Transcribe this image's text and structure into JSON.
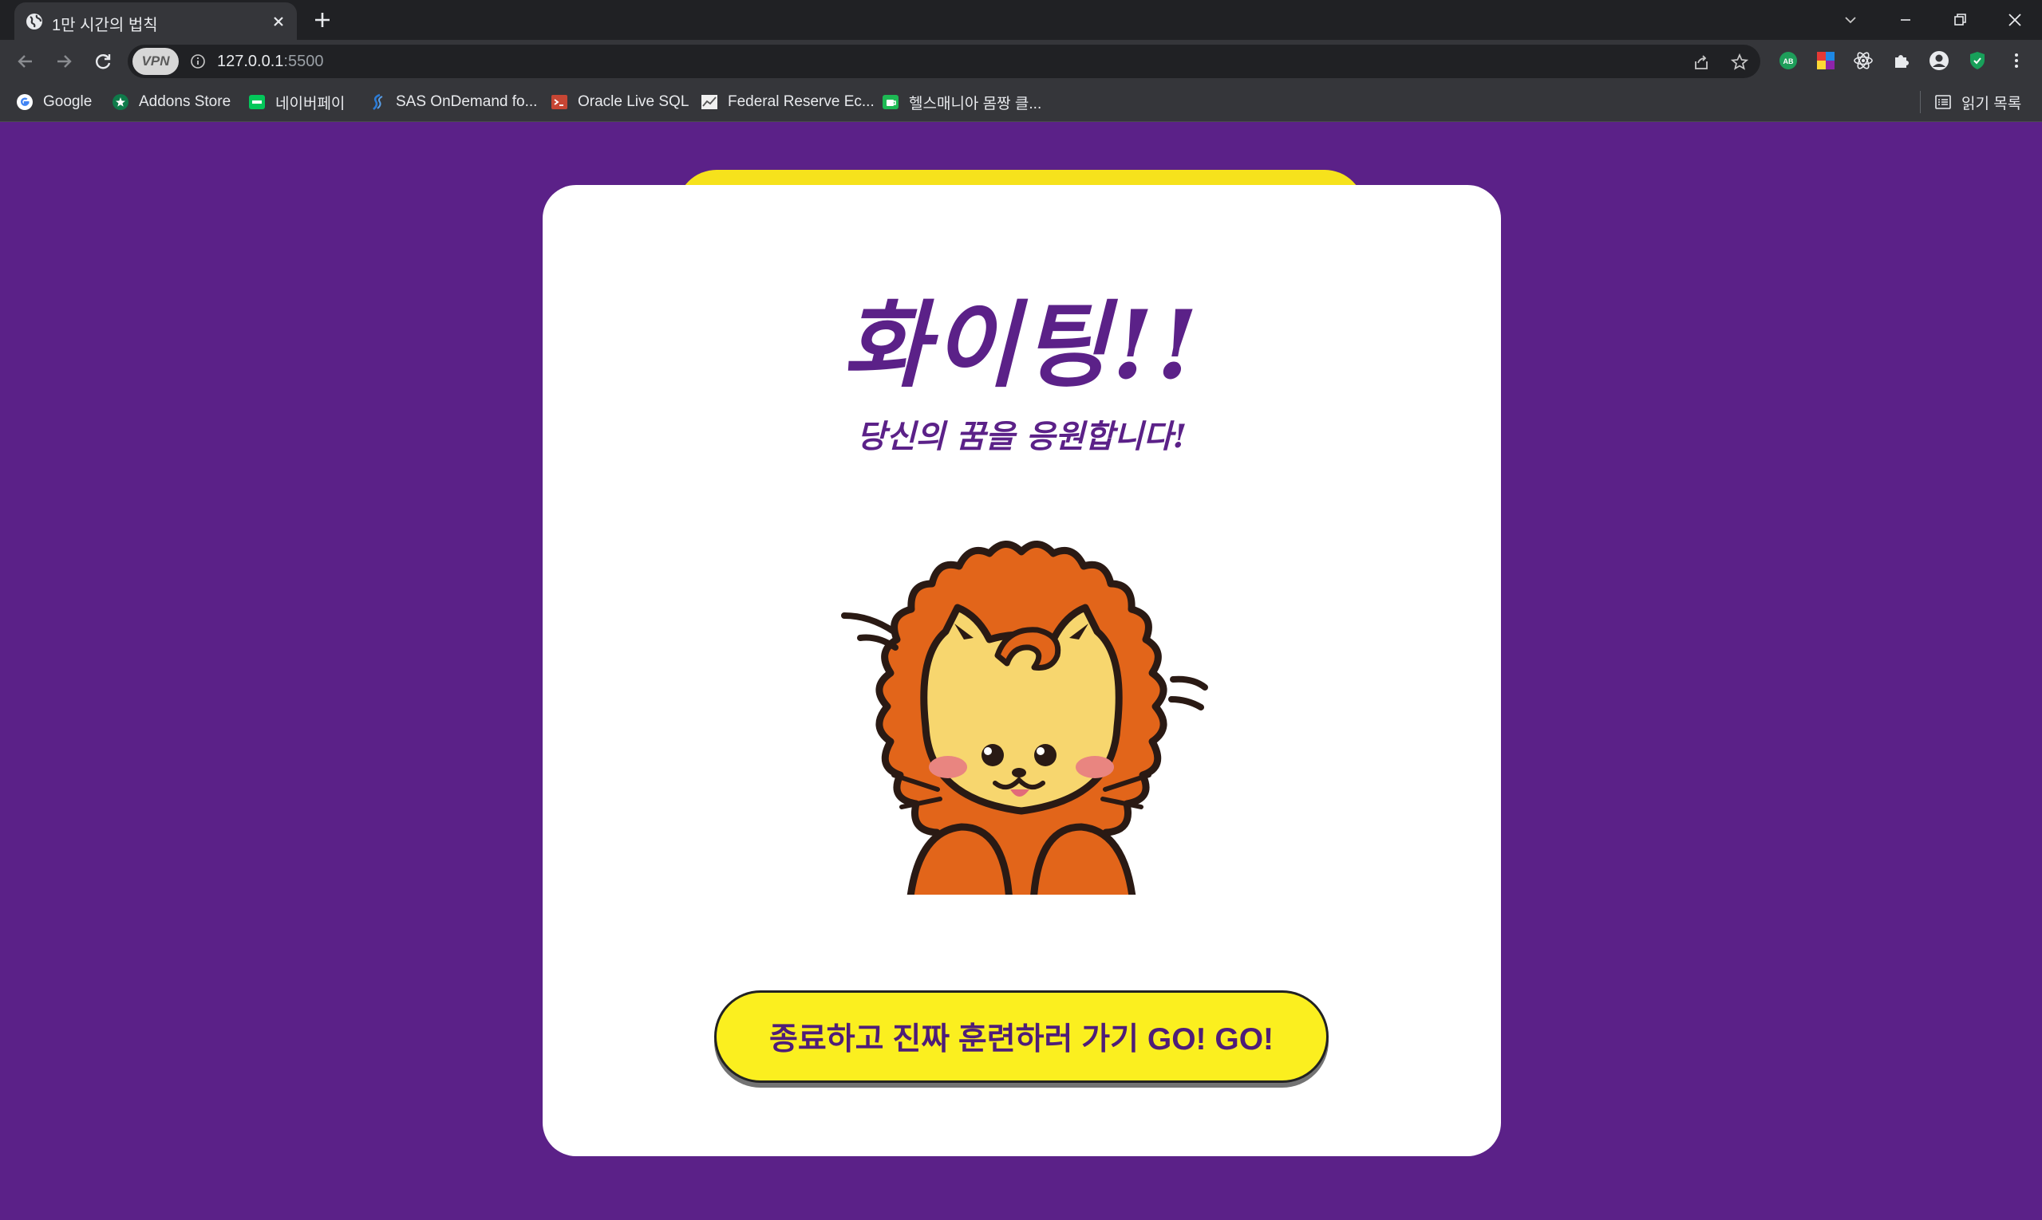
{
  "browser": {
    "tab_title": "1만 시간의 법칙",
    "url_host": "127.0.0.1",
    "url_port": ":5500",
    "vpn_label": "VPN",
    "reading_list_label": "읽기 목록"
  },
  "bookmarks": [
    {
      "label": "Google",
      "icon": "google-icon",
      "color": "#4285f4"
    },
    {
      "label": "Addons Store",
      "icon": "addons-store-icon",
      "color": "#0f7a4a"
    },
    {
      "label": "네이버페이",
      "icon": "naver-pay-icon",
      "color": "#03c75a"
    },
    {
      "label": "SAS OnDemand fo...",
      "icon": "sas-icon",
      "color": "#2b7bd6"
    },
    {
      "label": "Oracle Live SQL",
      "icon": "oracle-icon",
      "color": "#c74634"
    },
    {
      "label": "Federal Reserve Ec...",
      "icon": "fred-icon",
      "color": "#8a8a8a"
    },
    {
      "label": "헬스매니아 몸짱 클...",
      "icon": "healthmania-icon",
      "color": "#1db954"
    }
  ],
  "page": {
    "heading": "화이팅!!",
    "subheading": "당신의 꿈을 응원합니다!",
    "button_label": "종료하고 진짜 훈련하러 가기 GO! GO!",
    "colors": {
      "background": "#5b2188",
      "accent_yellow": "#f6e21c",
      "card": "#ffffff",
      "text_purple": "#5b2188"
    }
  }
}
